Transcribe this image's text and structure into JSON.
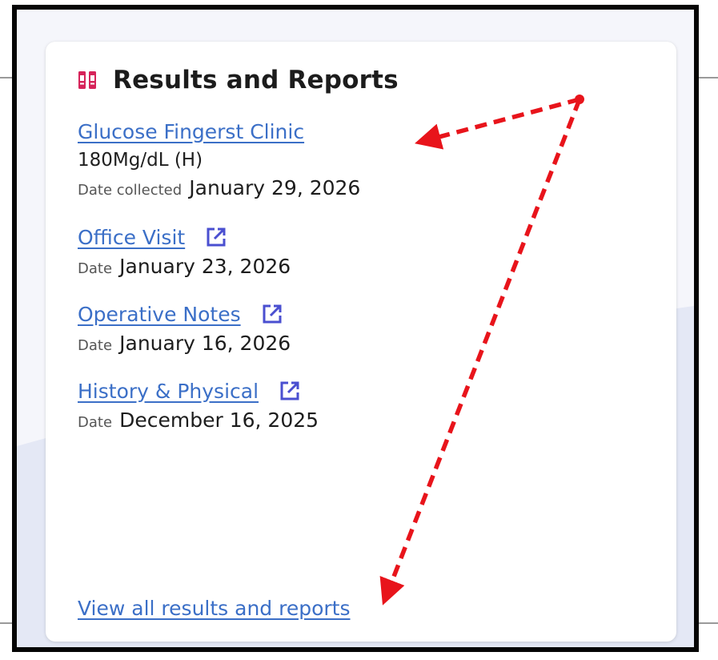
{
  "card": {
    "title": "Results and Reports",
    "entries": [
      {
        "link": "Glucose Fingerst Clinic",
        "value": "180Mg/dL (H)",
        "date_label": "Date collected",
        "date": "January 29, 2026",
        "has_external_icon": false
      },
      {
        "link": "Office Visit",
        "date_label": "Date",
        "date": "January 23, 2026",
        "has_external_icon": true
      },
      {
        "link": "Operative Notes",
        "date_label": "Date",
        "date": "January 16, 2026",
        "has_external_icon": true
      },
      {
        "link": "History & Physical",
        "date_label": "Date",
        "date": "December 16, 2025",
        "has_external_icon": true
      }
    ],
    "view_all_link": "View all results and reports"
  },
  "icons": {
    "header_icon": "lab-report-icon",
    "external_link": "external-link-icon"
  },
  "colors": {
    "link": "#3b6fc7",
    "header_icon": "#d6245a",
    "external_icon": "#4a4fd0",
    "annotation": "#e8141b",
    "frame": "#050505"
  }
}
